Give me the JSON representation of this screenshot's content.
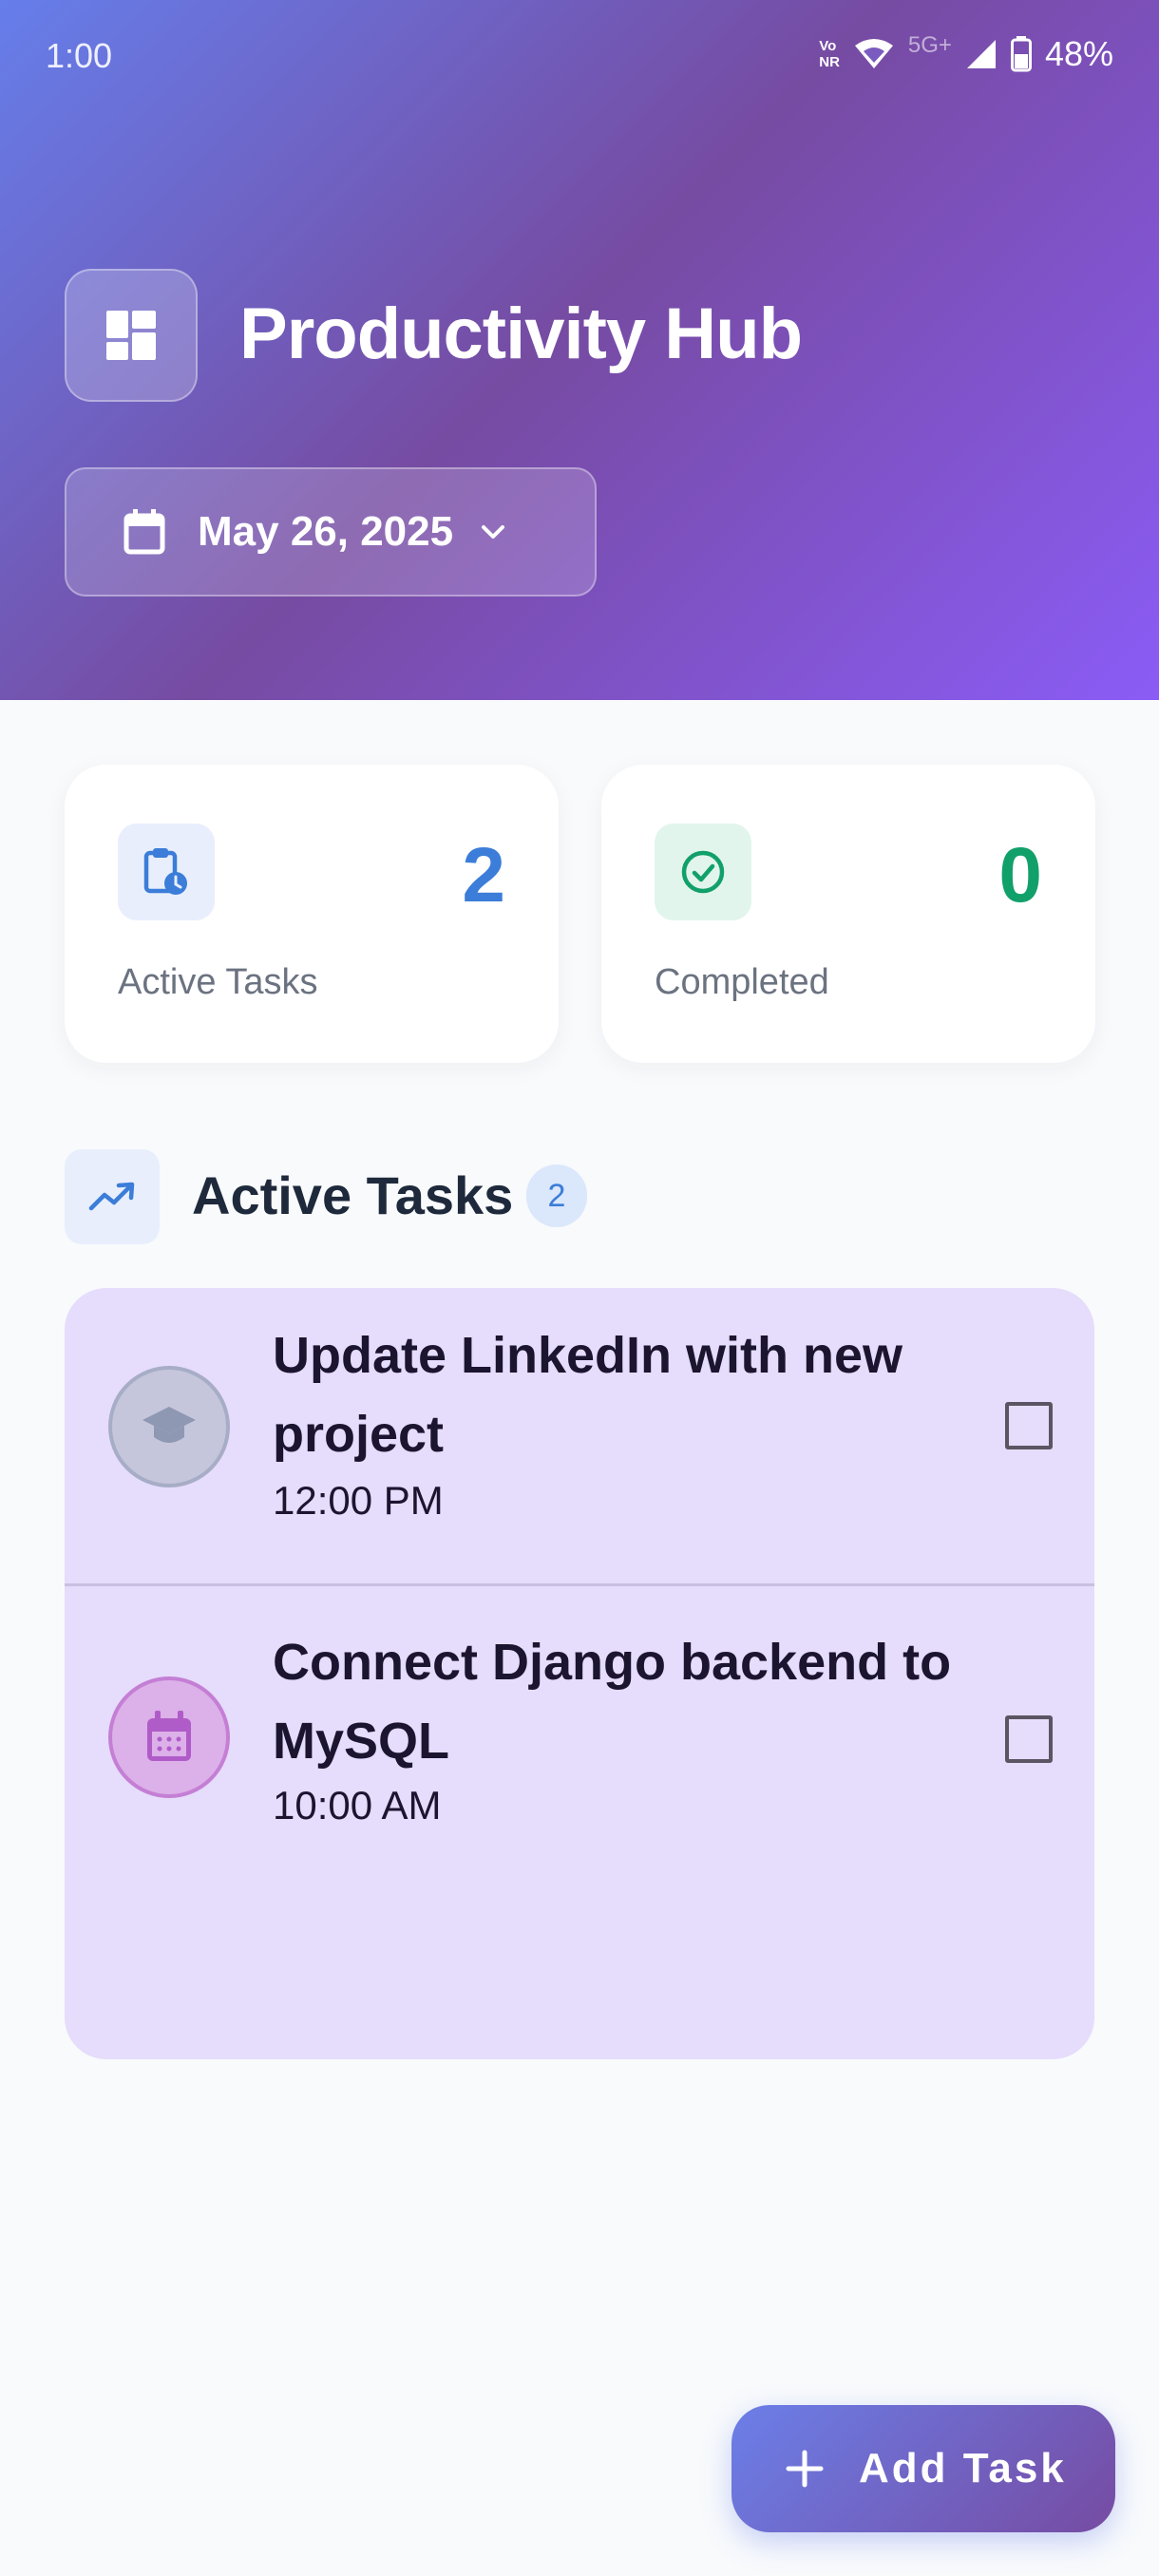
{
  "status_bar": {
    "time": "1:00",
    "volte_top": "Vo",
    "volte_bottom": "NR",
    "network": "5G+",
    "battery": "48%"
  },
  "header": {
    "title": "Productivity Hub",
    "logo_icon": "dashboard-icon",
    "date_selector": {
      "label": "May 26, 2025",
      "icon": "calendar-icon",
      "chevron": "chevron-down-icon"
    }
  },
  "stats": [
    {
      "label": "Active Tasks",
      "value": "2",
      "icon": "clipboard-clock-icon",
      "color": "#3b7dd8",
      "bg": "#e8eefc"
    },
    {
      "label": "Completed",
      "value": "0",
      "icon": "check-circle-icon",
      "color": "#12a06a",
      "bg": "#e1f5ec"
    }
  ],
  "section": {
    "title": "Active Tasks",
    "count": "2",
    "icon": "trending-up-icon"
  },
  "tasks": [
    {
      "title": "Update LinkedIn with new project",
      "time": "12:00 PM",
      "icon": "graduation-cap-icon",
      "checked": false
    },
    {
      "title": "Connect Django backend to MySQL",
      "time": "10:00 AM",
      "icon": "calendar-icon",
      "checked": false
    }
  ],
  "fab": {
    "label": "Add Task",
    "icon": "plus-icon"
  },
  "colors": {
    "header_gradient_start": "#667eea",
    "header_gradient_mid": "#764ba2",
    "header_gradient_end": "#8b5cf6",
    "task_list_bg": "#e6dcfb",
    "page_bg": "#f8fafc"
  }
}
